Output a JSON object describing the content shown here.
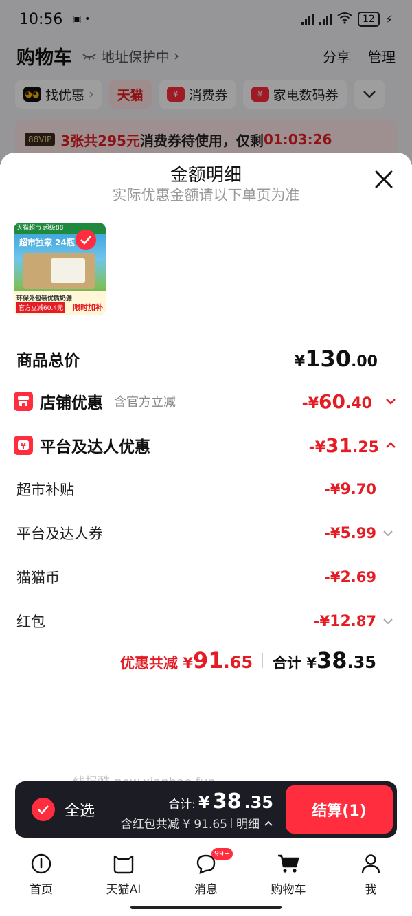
{
  "status_bar": {
    "time": "10:56",
    "battery": "12"
  },
  "cart_header": {
    "title": "购物车",
    "address_protect": "地址保护中",
    "share": "分享",
    "manage": "管理"
  },
  "chips": [
    {
      "label": "找优惠",
      "active": false
    },
    {
      "label": "天猫",
      "active": true
    },
    {
      "label": "消费券",
      "active": false
    },
    {
      "label": "家电数码券",
      "active": false
    }
  ],
  "vip_banner": {
    "tag": "88VIP",
    "highlight": "3张共295元",
    "text": "消费券待使用，仅剩",
    "countdown": "01:03:26"
  },
  "sheet": {
    "title": "金额明细",
    "subtitle": "实际优惠金额请以下单页为准"
  },
  "product": {
    "top_text": "天猫超市 超级88",
    "slogan": "超市独家 24瓶",
    "line1": "环保外包装优质奶源",
    "line2": "官方立减60.4元",
    "line3": "限时加补"
  },
  "rows": {
    "total": {
      "label": "商品总价",
      "sym": "¥",
      "int": "130",
      "dec": ".00"
    },
    "store": {
      "label": "店铺优惠",
      "hint": "含官方立减",
      "sym": "-¥",
      "int": "60",
      "dec": ".40"
    },
    "platform": {
      "label": "平台及达人优惠",
      "sym": "-¥",
      "int": "31",
      "dec": ".25"
    },
    "subsidy": {
      "label": "超市补贴",
      "sym": "-¥",
      "int": "9",
      "dec": ".70"
    },
    "coupon": {
      "label": "平台及达人券",
      "sym": "-¥",
      "int": "5",
      "dec": ".99"
    },
    "coin": {
      "label": "猫猫币",
      "sym": "-¥",
      "int": "2",
      "dec": ".69"
    },
    "redpacket": {
      "label": "红包",
      "sym": "-¥",
      "int": "12",
      "dec": ".87"
    }
  },
  "summary": {
    "discount_label": "优惠共减",
    "discount_sym": "¥",
    "discount_int": "91",
    "discount_dec": ".65",
    "total_label": "合计",
    "total_sym": "¥",
    "total_int": "38",
    "total_dec": ".35"
  },
  "watermark": "线报酷-new.xianbao.fun",
  "checkout": {
    "select_all": "全选",
    "total_label": "合计:",
    "total_sym": "¥",
    "total_int": "38",
    "total_dec": ".35",
    "detail_text": "含红包共减 ¥ 91.65",
    "detail_link": "明细",
    "pay_label": "结算(1)"
  },
  "tabs": [
    {
      "label": "首页",
      "icon": "home-icon"
    },
    {
      "label": "天猫AI",
      "icon": "tmall-ai-icon"
    },
    {
      "label": "消息",
      "icon": "message-icon",
      "badge": "99+"
    },
    {
      "label": "购物车",
      "icon": "cart-icon"
    },
    {
      "label": "我",
      "icon": "profile-icon"
    }
  ],
  "colors": {
    "accent": "#ff2d3e",
    "price_red": "#e51c23",
    "bar_dark": "#1c1c24"
  }
}
